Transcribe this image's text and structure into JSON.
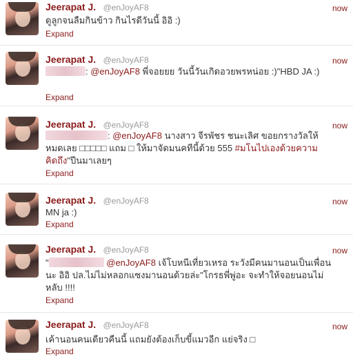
{
  "author": {
    "name": "Jeerapat J.",
    "handle": "@enJoyAF8"
  },
  "expand_label": "Expand",
  "tweets": [
    {
      "time": "now",
      "parts": [
        "ดูลูกจนลืมกินข้าว กินไรดีวันนี้ อิอิ :)"
      ]
    },
    {
      "time": "now",
      "parts": [
        ": ",
        "@enJoyAF8",
        " พี่จอยยย วันนี้วันเกิดอวยพรหน่อย :)\"HBD JA :)"
      ]
    },
    {
      "time": "now",
      "parts": [
        ": ",
        "@enJoyAF8",
        " นางสาว จีรพัชร ชนะเลิศ ขอยกรางวัลให้หมดเลย □□□□□ แถม □ ให้มาจัดมนคทีนี้ด้วย 555 ",
        "#มโนไปเองด้วยความคิดถึง",
        "\"ปีนมาเลยๆ"
      ]
    },
    {
      "time": "now",
      "parts": [
        "MN ja :)"
      ]
    },
    {
      "time": "now",
      "parts": [
        "\"",
        "@enJoyAF8",
        " เจ้โบหนีเที่ยวเหรอ ระวังมีคนมานอนเป็นเพื่อนนะ อิอิ ปล.ไม่ไม่หลอกแซงมานอนด้วยล่ะ\"โกรธพี่พู่อะ จะทำให้จอยนอนไม่หลับ !!!!"
      ]
    },
    {
      "time": "now",
      "parts": [
        "เค้านอนคนเดียวคืนนี้ แถมยังต้องเก็บขี้แมวอีก แย่จริง □"
      ]
    }
  ]
}
